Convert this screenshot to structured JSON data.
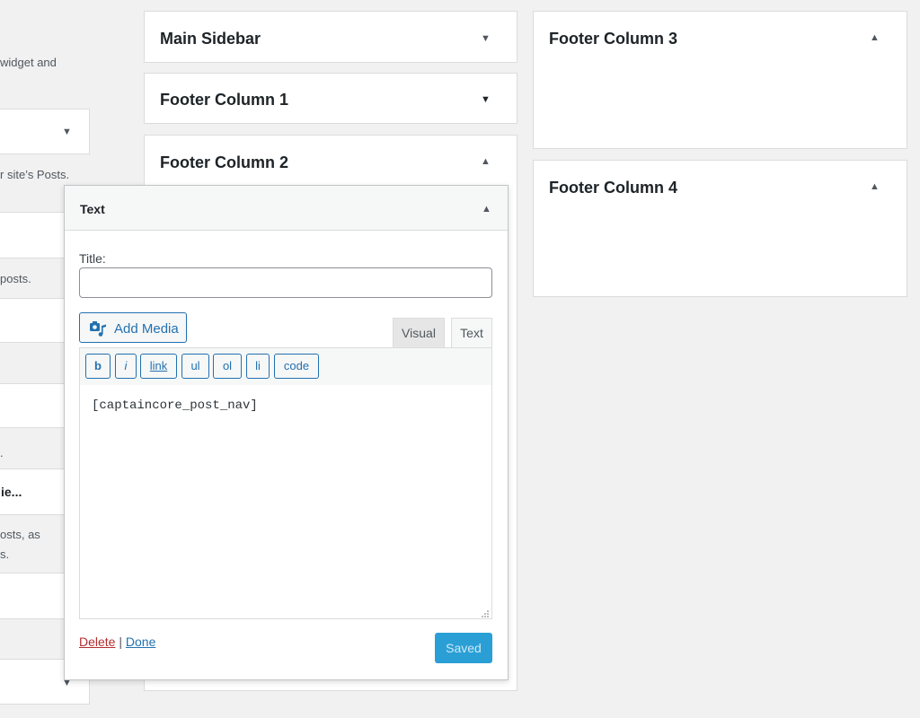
{
  "left_column": {
    "desc_fragment": "widget and",
    "dropdown_1_arrow": "▼",
    "categories_desc": "r site’s Posts.",
    "recent_posts_desc": "posts.",
    "fragment_dot": ".",
    "truncated_title": "ie...",
    "desc_line_1": "osts, as",
    "desc_line_2": "s.",
    "dropdown_2_arrow": "▼"
  },
  "sidebars": {
    "main_sidebar": {
      "title": "Main Sidebar",
      "toggle": "▼"
    },
    "footer_column_1": {
      "title": "Footer Column 1",
      "toggle": "▼"
    },
    "footer_column_2": {
      "title": "Footer Column 2",
      "toggle": "▲"
    },
    "footer_column_3": {
      "title": "Footer Column 3",
      "toggle": "▲"
    },
    "footer_column_4": {
      "title": "Footer Column 4",
      "toggle": "▲"
    }
  },
  "text_widget": {
    "header_title": "Text",
    "toggle": "▲",
    "title_label": "Title:",
    "title_value": "",
    "add_media_label": "Add Media",
    "tab_visual": "Visual",
    "tab_text": "Text",
    "quicktags": [
      "b",
      "i",
      "link",
      "ul",
      "ol",
      "li",
      "code"
    ],
    "content": "[captaincore_post_nav]",
    "delete_label": "Delete",
    "separator": "|",
    "done_label": "Done",
    "saved_label": "Saved"
  },
  "colors": {
    "accent": "#2271b1",
    "delete_red": "#b32d2e",
    "saved_bg": "#2a9fd6",
    "background": "#f1f1f1"
  },
  "icons": {
    "add_media": "camera-music-icon",
    "resize": "resize-grip-icon"
  }
}
